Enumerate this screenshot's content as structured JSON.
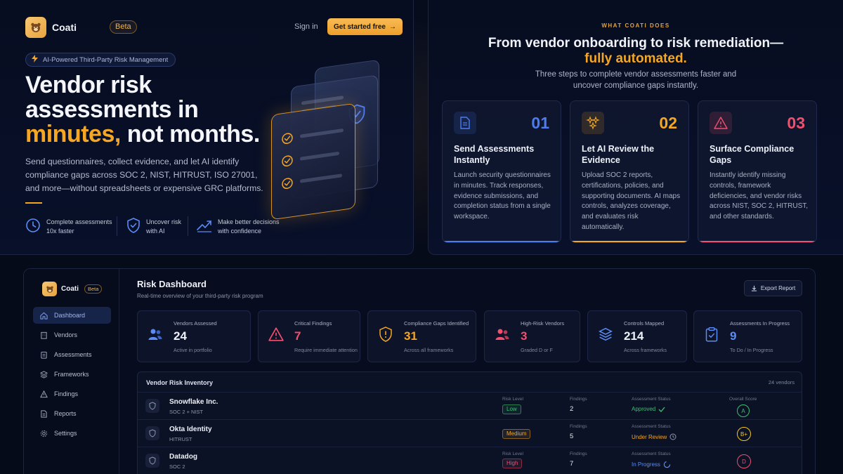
{
  "brand": {
    "name": "Coati",
    "beta": "Beta"
  },
  "hero": {
    "signin": "Sign in",
    "cta": "Get started free",
    "cta_arrow": "→",
    "pill": "AI-Powered Third-Party Risk Management",
    "title_l1": "Vendor risk",
    "title_l2": "assessments in",
    "title_accent": "minutes,",
    "title_end": " not months.",
    "description": "Send questionnaires, collect evidence, and let AI identify compliance gaps across SOC 2, NIST, HITRUST, ISO 27001, and more—without spreadsheets or expensive GRC platforms.",
    "features": [
      {
        "l1": "Complete assessments",
        "l2": "10x faster",
        "icon": "clock-icon"
      },
      {
        "l1": "Uncover risk",
        "l2": "with AI",
        "icon": "shield-check-icon"
      },
      {
        "l1": "Make better decisions",
        "l2": "with confidence",
        "icon": "trend-up-icon"
      }
    ]
  },
  "steps": {
    "eyebrow": "WHAT COATI DOES",
    "heading_l1": "From vendor onboarding to risk remediation—",
    "heading_l2": "fully automated.",
    "subheading": "Three steps to complete vendor assessments faster and uncover compliance gaps instantly.",
    "cards": [
      {
        "num": "01",
        "title": "Send Assessments Instantly",
        "desc": "Launch security questionnaires in minutes. Track responses, evidence submissions, and completion status from a single workspace.",
        "color": "#4d7cf0",
        "icon": "document-icon"
      },
      {
        "num": "02",
        "title": "Let AI Review the Evidence",
        "desc": "Upload SOC 2 reports, certifications, policies, and supporting documents. AI maps controls, analyzes coverage, and evaluates risk automatically.",
        "color": "#f5a623",
        "icon": "sparkles-icon"
      },
      {
        "num": "03",
        "title": "Surface Compliance Gaps",
        "desc": "Instantly identify missing controls, framework deficiencies, and vendor risks across NIST, SOC 2, HITRUST, and other standards.",
        "color": "#f0506e",
        "icon": "warning-icon"
      }
    ]
  },
  "dashboard": {
    "nav": [
      {
        "label": "Dashboard",
        "icon": "home-icon",
        "active": true
      },
      {
        "label": "Vendors",
        "icon": "building-icon"
      },
      {
        "label": "Assessments",
        "icon": "clipboard-icon"
      },
      {
        "label": "Frameworks",
        "icon": "layers-icon"
      },
      {
        "label": "Findings",
        "icon": "warning-icon"
      },
      {
        "label": "Reports",
        "icon": "report-icon"
      },
      {
        "label": "Settings",
        "icon": "gear-icon"
      }
    ],
    "title": "Risk Dashboard",
    "subtitle": "Real-time overview of your third-party risk program",
    "export": "Export Report",
    "stats": [
      {
        "label": "Vendors Assessed",
        "value": "24",
        "note": "Active in portfolio",
        "color": "#5b8cf5",
        "icon": "users-icon"
      },
      {
        "label": "Critical Findings",
        "value": "7",
        "note": "Require immediate attention",
        "color": "#f0506e",
        "icon": "warning-icon"
      },
      {
        "label": "Compliance Gaps Identified",
        "value": "31",
        "note": "Across all frameworks",
        "color": "#f5a623",
        "icon": "shield-alert-icon"
      },
      {
        "label": "High-Risk Vendors",
        "value": "3",
        "note": "Graded D or F",
        "color": "#f0506e",
        "icon": "users-alert-icon"
      },
      {
        "label": "Controls Mapped",
        "value": "214",
        "note": "Across frameworks",
        "color": "#5b8cf5",
        "icon": "layers-icon"
      },
      {
        "label": "Assessments In Progress",
        "value": "9",
        "note": "To Do / In Progress",
        "color": "#5b8cf5",
        "icon": "clipboard-check-icon"
      }
    ],
    "inventory": {
      "title": "Vendor Risk Inventory",
      "count": "24 vendors",
      "cap_risk": "Risk Level",
      "cap_findings": "Findings",
      "cap_status": "Assessment Status",
      "cap_score": "Overall Score",
      "rows": [
        {
          "name": "Snowflake Inc.",
          "framework": "SOC 2 + NIST",
          "risk": "Low",
          "risk_color": "#3fbf6f",
          "findings": "2",
          "status": "Approved",
          "status_color": "#3fbf6f",
          "score": "A",
          "score_color": "#3fbf6f"
        },
        {
          "name": "Okta Identity",
          "framework": "HITRUST",
          "risk": "Medium",
          "risk_color": "#f5a623",
          "findings": "5",
          "status": "Under Review",
          "status_color": "#f5a623",
          "score": "B+",
          "score_color": "#f5c623"
        },
        {
          "name": "Datadog",
          "framework": "SOC 2",
          "risk": "High",
          "risk_color": "#f0506e",
          "findings": "7",
          "status": "In Progress",
          "status_color": "#5b8cf5",
          "score": "D",
          "score_color": "#f0506e"
        }
      ]
    }
  }
}
